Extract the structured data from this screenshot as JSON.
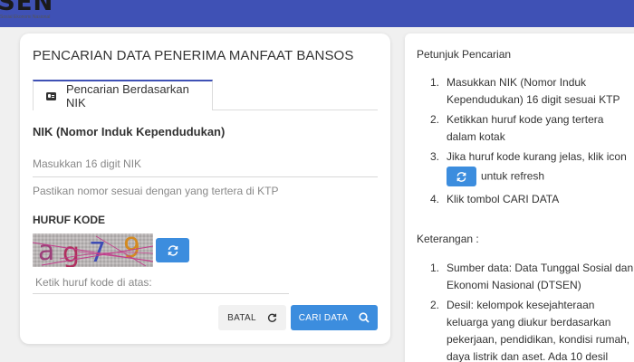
{
  "header": {
    "logo_text": "SEN",
    "logo_subtext": "Sosial Ekonomi Nasional",
    "color": "#3f51b5"
  },
  "search_card": {
    "title": "PENCARIAN DATA PENERIMA MANFAAT BANSOS",
    "tab_label": "Pencarian Berdasarkan NIK",
    "tab_icon": "id-card-icon",
    "nik_label": "NIK (Nomor Induk Kependudukan)",
    "nik_placeholder": "Masukkan 16 digit NIK",
    "nik_value": "",
    "nik_hint": "Pastikan nomor sesuai dengan yang tertera di KTP",
    "kode_label": "HURUF KODE",
    "captcha_text": "ag79",
    "kode_placeholder": "Ketik huruf kode di atas:",
    "kode_value": "",
    "cancel_label": "BATAL",
    "search_label": "CARI DATA",
    "accent_color": "#3c8dde"
  },
  "instructions": {
    "title": "Petunjuk Pencarian",
    "steps": [
      {
        "num": "1.",
        "text": "Masukkan NIK (Nomor Induk Kependudukan) 16 digit sesuai KTP"
      },
      {
        "num": "2.",
        "text": "Ketikkan huruf kode yang tertera dalam kotak"
      },
      {
        "num": "3.",
        "text_before": "Jika huruf kode kurang jelas, klik icon",
        "text_after": "untuk refresh"
      },
      {
        "num": "4.",
        "text": "Klik tombol CARI DATA"
      }
    ],
    "notes_title": "Keterangan :",
    "notes": [
      {
        "num": "1.",
        "text": "Sumber data: Data Tunggal Sosial dan Ekonomi Nasional (DTSEN)"
      },
      {
        "num": "2.",
        "text": "Desil: kelompok kesejahteraan keluarga yang diukur berdasarkan pekerjaan, pendidikan, kondisi rumah, daya listrik dan aset. Ada 10 desil"
      }
    ]
  }
}
